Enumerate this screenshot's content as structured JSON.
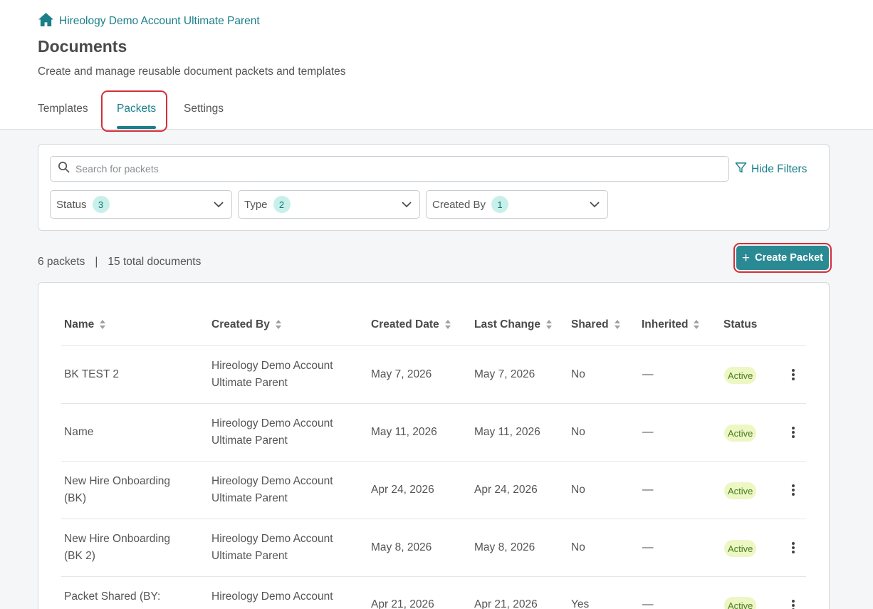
{
  "breadcrumb": {
    "label": "Hireology Demo Account Ultimate Parent"
  },
  "page": {
    "title": "Documents",
    "subtitle": "Create and manage reusable document packets and templates"
  },
  "tabs": [
    {
      "label": "Templates",
      "active": false
    },
    {
      "label": "Packets",
      "active": true
    },
    {
      "label": "Settings",
      "active": false
    }
  ],
  "filters": {
    "search_placeholder": "Search for packets",
    "search_value": "",
    "hide_filters_label": "Hide Filters",
    "dropdowns": [
      {
        "label": "Status",
        "count": "3"
      },
      {
        "label": "Type",
        "count": "2"
      },
      {
        "label": "Created By",
        "count": "1"
      }
    ]
  },
  "summary": {
    "packets": "6 packets",
    "separator": "|",
    "documents": "15 total documents"
  },
  "create_button": {
    "plus": "+",
    "label": "Create Packet"
  },
  "table": {
    "headers": [
      "Name",
      "Created By",
      "Created Date",
      "Last Change",
      "Shared",
      "Inherited",
      "Status"
    ],
    "rows": [
      {
        "name": [
          "BK TEST 2"
        ],
        "created_by": [
          "Hireology Demo Account",
          "Ultimate Parent"
        ],
        "created_date": "May 7, 2026",
        "last_change": "May 7, 2026",
        "shared": "No",
        "inherited": "—",
        "status": "Active"
      },
      {
        "name": [
          "Name"
        ],
        "created_by": [
          "Hireology Demo Account",
          "Ultimate Parent"
        ],
        "created_date": "May 11, 2026",
        "last_change": "May 11, 2026",
        "shared": "No",
        "inherited": "—",
        "status": "Active"
      },
      {
        "name": [
          "New Hire Onboarding",
          "(BK)"
        ],
        "created_by": [
          "Hireology Demo Account",
          "Ultimate Parent"
        ],
        "created_date": "Apr 24, 2026",
        "last_change": "Apr 24, 2026",
        "shared": "No",
        "inherited": "—",
        "status": "Active"
      },
      {
        "name": [
          "New Hire Onboarding",
          "(BK 2)"
        ],
        "created_by": [
          "Hireology Demo Account",
          "Ultimate Parent"
        ],
        "created_date": "May 8, 2026",
        "last_change": "May 8, 2026",
        "shared": "No",
        "inherited": "—",
        "status": "Active"
      },
      {
        "name": [
          "Packet Shared (BY:"
        ],
        "created_by": [
          "Hireology Demo Account"
        ],
        "created_date": "Apr 21, 2026",
        "last_change": "Apr 21, 2026",
        "shared": "Yes",
        "inherited": "—",
        "status": "Active"
      }
    ]
  },
  "colors": {
    "accent": "#1a7f89",
    "button": "#2a8a94",
    "highlight": "#d42f3a",
    "active_pill_bg": "#ecf7c4",
    "badge_bg": "#c8f0ea"
  }
}
